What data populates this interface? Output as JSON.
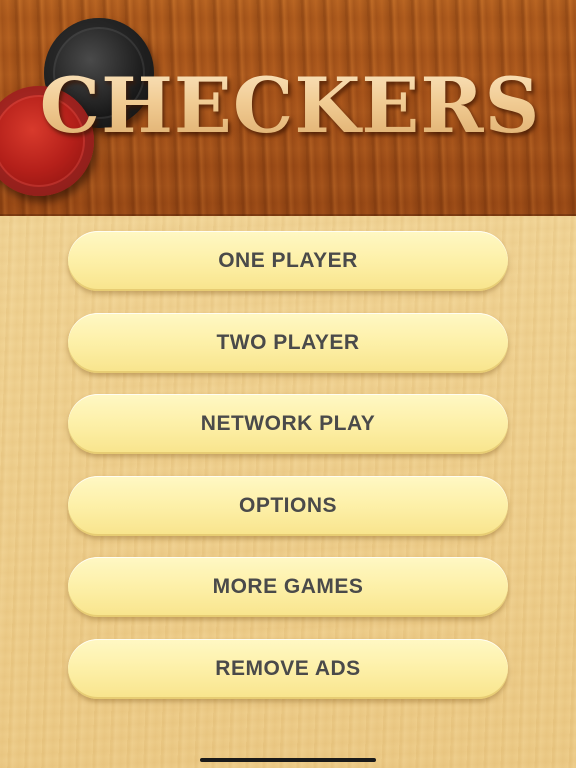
{
  "app": {
    "title": "CHECKERS",
    "header_icons": [
      "black-checker-piece-icon",
      "red-checker-piece-icon"
    ]
  },
  "menu": {
    "items": [
      {
        "label": "ONE PLAYER"
      },
      {
        "label": "TWO PLAYER"
      },
      {
        "label": "NETWORK PLAY"
      },
      {
        "label": "OPTIONS"
      },
      {
        "label": "MORE GAMES"
      },
      {
        "label": "REMOVE ADS"
      }
    ]
  },
  "colors": {
    "header_wood": "#a8541a",
    "background_wood": "#f0d292",
    "button_fill": "#fdf0a8",
    "button_text": "#4a4a4a",
    "title_gold": "#f1cc94",
    "checker_black": "#1a1a1a",
    "checker_red": "#b5201a"
  }
}
